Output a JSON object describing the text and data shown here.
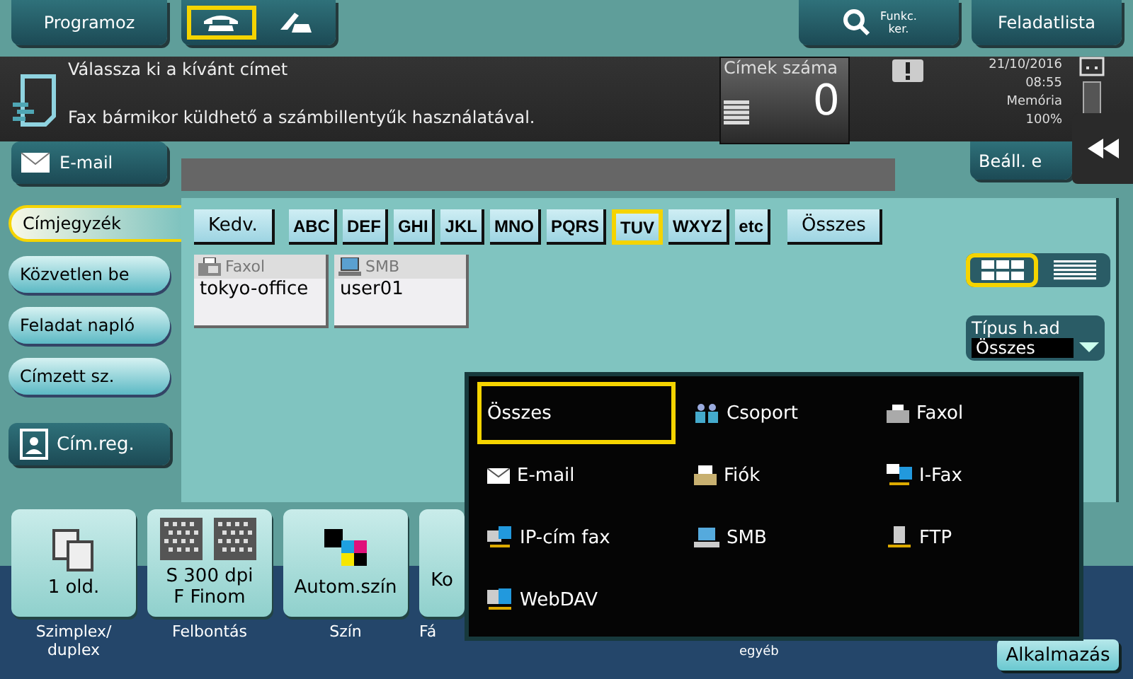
{
  "top_bar": {
    "program_button": "Programoz",
    "modes": [
      {
        "kind": "fax",
        "selected": true
      },
      {
        "kind": "phone",
        "selected": false
      }
    ],
    "search_button": [
      "Funkc.",
      "ker."
    ],
    "job_list_button": "Feladatlista"
  },
  "message": {
    "title": "Válassza ki a kívánt címet",
    "hint": "Fax bármikor küldhető a számbillentyűk használatával."
  },
  "address_count": {
    "label": "Címek száma",
    "value": "0"
  },
  "status": {
    "date": "21/10/2016",
    "time": "08:55",
    "memory_label": "Memória",
    "memory": "100%"
  },
  "email_button": "E-mail",
  "settings_button": "Beáll. e",
  "sidebar": [
    {
      "label": "Címjegyzék",
      "selected": true
    },
    {
      "label": "Közvetlen be",
      "selected": false
    },
    {
      "label": "Feladat napló",
      "selected": false
    },
    {
      "label": "Címzett sz.",
      "selected": false
    }
  ],
  "register_button": "Cím.reg.",
  "index_tabs": [
    {
      "label": "Kedv.",
      "kind": "plain",
      "selected": false
    },
    {
      "label": "ABC",
      "kind": "letters",
      "selected": false
    },
    {
      "label": "DEF",
      "kind": "letters",
      "selected": false
    },
    {
      "label": "GHI",
      "kind": "letters",
      "selected": false
    },
    {
      "label": "JKL",
      "kind": "letters",
      "selected": false
    },
    {
      "label": "MNO",
      "kind": "letters",
      "selected": false
    },
    {
      "label": "PQRS",
      "kind": "letters",
      "selected": false
    },
    {
      "label": "TUV",
      "kind": "letters",
      "selected": true
    },
    {
      "label": "WXYZ",
      "kind": "letters",
      "selected": false
    },
    {
      "label": "etc",
      "kind": "letters",
      "selected": false
    },
    {
      "label": "Összes",
      "kind": "plain",
      "selected": false
    }
  ],
  "addresses": [
    {
      "kind": "fax",
      "type": "Faxol",
      "name": "tokyo-office"
    },
    {
      "kind": "smb",
      "type": "SMB",
      "name": "user01"
    }
  ],
  "views": [
    {
      "kind": "grid",
      "selected": true
    },
    {
      "kind": "list",
      "selected": false
    }
  ],
  "type_filter": {
    "label": "Típus h.ad",
    "value": "Összes"
  },
  "type_menu": [
    {
      "label": "Összes",
      "kind": "all",
      "selected": true
    },
    {
      "label": "Csoport",
      "kind": "group",
      "selected": false
    },
    {
      "label": "Faxol",
      "kind": "fax",
      "selected": false
    },
    {
      "label": "E-mail",
      "kind": "email",
      "selected": false
    },
    {
      "label": "Fiók",
      "kind": "box",
      "selected": false
    },
    {
      "label": "I-Fax",
      "kind": "ifax",
      "selected": false
    },
    {
      "label": "IP-cím fax",
      "kind": "ipfax",
      "selected": false
    },
    {
      "label": "SMB",
      "kind": "smb",
      "selected": false
    },
    {
      "label": "FTP",
      "kind": "ftp",
      "selected": false
    },
    {
      "label": "WebDAV",
      "kind": "webdav",
      "selected": false
    }
  ],
  "functions": [
    {
      "kind": "duplex",
      "value": [
        "1 old."
      ],
      "label": [
        "Szimplex/",
        "duplex"
      ]
    },
    {
      "kind": "resolution",
      "value": [
        "S 300 dpi",
        "F Finom"
      ],
      "label": [
        "Felbontás"
      ]
    },
    {
      "kind": "color",
      "value": [
        "Autom.szín"
      ],
      "label": [
        "Szín"
      ]
    },
    {
      "kind": "partial",
      "value": [
        "Ko"
      ],
      "label": [
        "Fá"
      ]
    }
  ],
  "hidden_function_label": "egyéb",
  "apply_button": "Alkalmazás"
}
